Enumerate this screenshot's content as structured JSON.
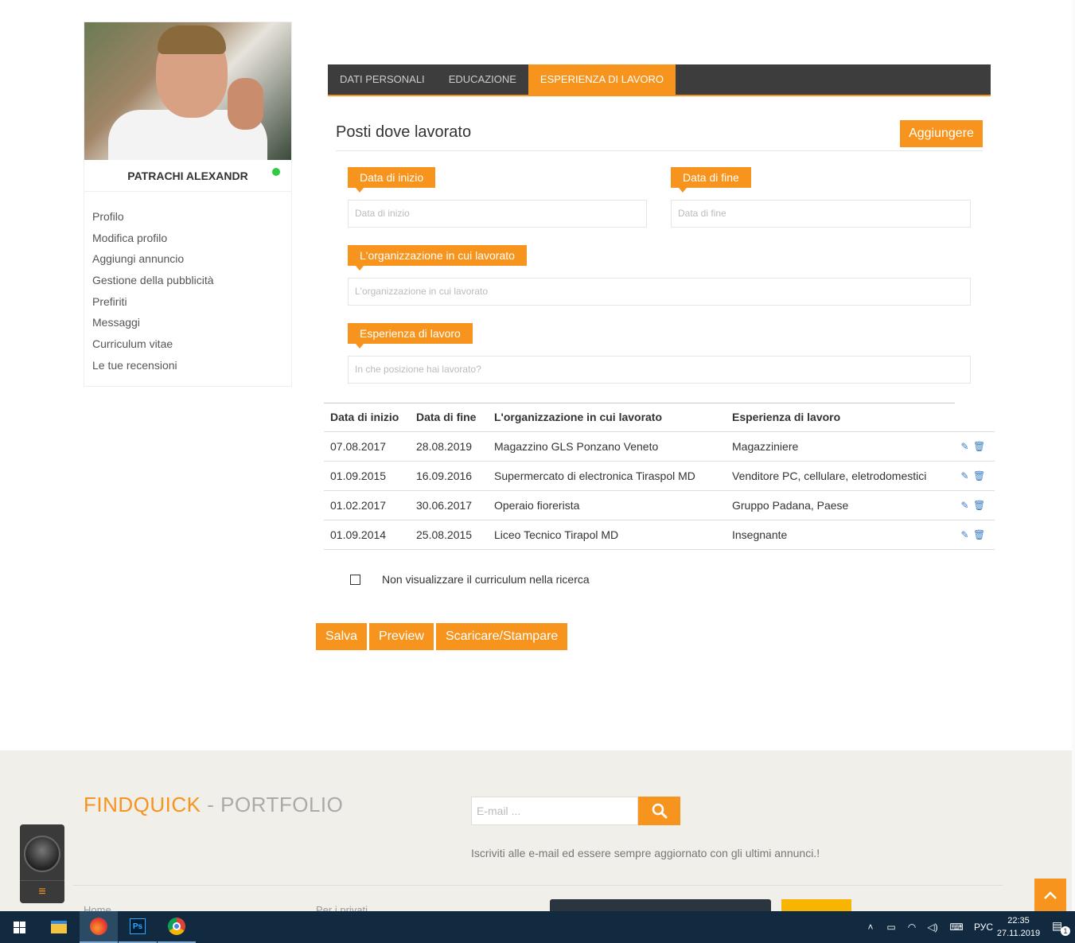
{
  "sidebar": {
    "username": "PATRACHI ALEXANDR",
    "menu": [
      "Profilo",
      "Modifica profilo",
      "Aggiungi annuncio",
      "Gestione della pubblicità",
      "Prefiriti",
      "Messaggi",
      "Curriculum vitae",
      "Le tue recensioni"
    ]
  },
  "tabs": [
    {
      "label": "DATI PERSONALI",
      "active": false
    },
    {
      "label": "EDUCAZIONE",
      "active": false
    },
    {
      "label": "ESPERIENZA DI LAVORO",
      "active": true
    }
  ],
  "section": {
    "title": "Posti dove lavorato",
    "add_label": "Aggiungere"
  },
  "form": {
    "start_label": "Data di inizio",
    "start_placeholder": "Data di inizio",
    "end_label": "Data di fine",
    "end_placeholder": "Data di fine",
    "org_label": "L'organizzazione in cui lavorato",
    "org_placeholder": "L'organizzazione in cui lavorato",
    "exp_label": "Esperienza di lavoro",
    "exp_placeholder": "In che posizione hai lavorato?"
  },
  "table": {
    "headers": [
      "Data di inizio",
      "Data di fine",
      "L'organizzazione in cui lavorato",
      "Esperienza di lavoro"
    ],
    "rows": [
      [
        "07.08.2017",
        "28.08.2019",
        "Magazzino GLS Ponzano Veneto",
        "Magazziniere"
      ],
      [
        "01.09.2015",
        "16.09.2016",
        "Supermercato di electronica Tiraspol MD",
        "Venditore PC, cellulare, eletrodomestici"
      ],
      [
        "01.02.2017",
        "30.06.2017",
        "Operaio fiorerista",
        "Gruppo Padana, Paese"
      ],
      [
        "01.09.2014",
        "25.08.2015",
        "Liceo Tecnico Tirapol MD",
        "Insegnante"
      ]
    ]
  },
  "checkbox": {
    "label": "Non visualizzare il curriculum nella ricerca",
    "checked": false
  },
  "actions": {
    "save": "Salva",
    "preview": "Preview",
    "download": "Scaricare/Stampare"
  },
  "footer": {
    "brand_main": "FINDQUICK",
    "brand_sep": " - ",
    "brand_rest": "PORTFOLIO",
    "email_placeholder": "E-mail ...",
    "subscribe_text": "Iscriviti alle e-mail ed essere sempre aggiornato con gli ultimi annunci.!",
    "link_home": "Home",
    "link_privati": "Per i privati"
  },
  "taskbar": {
    "language": "РУС",
    "time": "22:35",
    "date": "27.11.2019",
    "notifications": "1",
    "ps_label": "Ps"
  },
  "colors": {
    "accent": "#f7941d",
    "tabs_bg": "#3d3d3d",
    "taskbar_bg": "#112a3f",
    "footer_bg": "#f0efea",
    "online": "#2ecc40",
    "action_icon": "#3b7dc4"
  },
  "icons": {
    "edit": "edit-icon",
    "delete": "trash-icon",
    "search": "search-icon",
    "scroll_top": "chevron-up-icon",
    "chat_menu": "hamburger-icon"
  }
}
